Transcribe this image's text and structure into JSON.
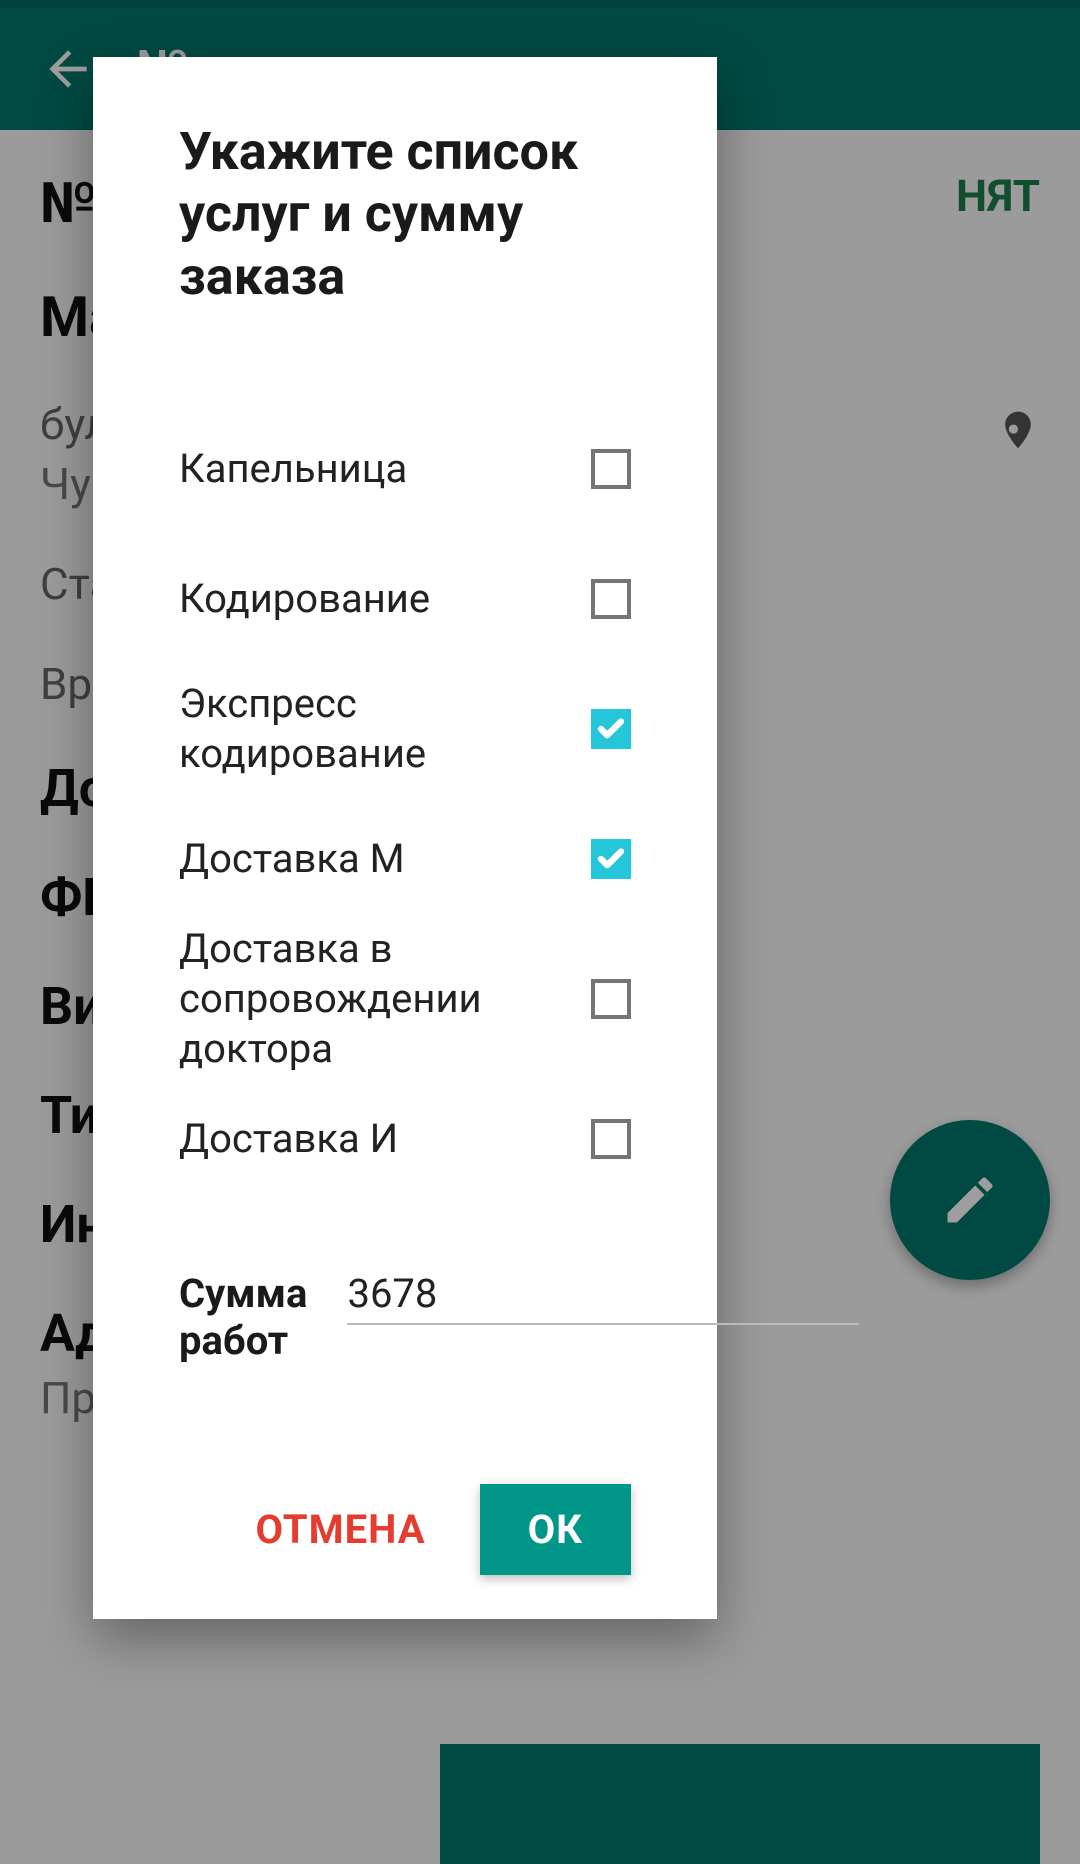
{
  "background": {
    "app_title_partial": "№",
    "status_badge_partial": "НЯТ",
    "rows": {
      "num": "№",
      "ma": "Ма",
      "addr1": "бул",
      "addr2": "Чув",
      "sta": "Ста",
      "vre": "Вре",
      "do": "До",
      "fio": "ФИ",
      "vid": "Вид",
      "tip": "Тип",
      "int": "Инт",
      "adr": "Адр",
      "pre": "Пре"
    }
  },
  "modal": {
    "title": "Укажите список услуг и сумму заказа",
    "services": [
      {
        "label": "Капельница",
        "checked": false
      },
      {
        "label": "Кодирование",
        "checked": false
      },
      {
        "label": "Экспресс кодирование",
        "checked": true
      },
      {
        "label": "Доставка М",
        "checked": true
      },
      {
        "label": "Доставка в сопровождении доктора",
        "checked": false
      },
      {
        "label": "Доставка И",
        "checked": false
      }
    ],
    "sum_label": "Сумма работ",
    "sum_value": "3678",
    "cancel_label": "ОТМЕНА",
    "ok_label": "ОК"
  }
}
